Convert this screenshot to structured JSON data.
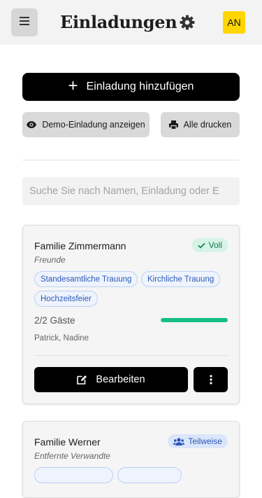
{
  "header": {
    "title": "Einladungen",
    "avatar_initials": "AN",
    "avatar_color": "#ffd600",
    "menu_icon": "hamburger-icon",
    "settings_icon": "gear-icon"
  },
  "actions": {
    "add_label": "Einladung hinzufügen",
    "add_icon": "plus-icon",
    "demo_label": "Demo-Einladung anzeigen",
    "demo_icon": "eye-icon",
    "print_label": "Alle drucken",
    "print_icon": "printer-icon"
  },
  "search": {
    "placeholder": "Suche Sie nach Namen, Einladung oder E",
    "value": ""
  },
  "invitations": [
    {
      "name": "Familie Zimmermann",
      "group": "Freunde",
      "status": "Voll",
      "status_icon": "check-icon",
      "status_color": "#137a4f",
      "tags": [
        "Standesamtliche Trauung",
        "Kirchliche Trauung",
        "Hochzeitsfeier"
      ],
      "guests": "2/2 Gäste",
      "progress": 1.0,
      "progress_color": "#13bf82",
      "people": "Patrick, Nadine",
      "edit_label": "Bearbeiten",
      "edit_icon": "edit-icon",
      "more_icon": "more-vertical-icon"
    },
    {
      "name": "Familie Werner",
      "group": "Entfernte Verwandte",
      "status": "Teilweise",
      "status_icon": "users-icon",
      "status_color": "#2a56b8"
    }
  ]
}
